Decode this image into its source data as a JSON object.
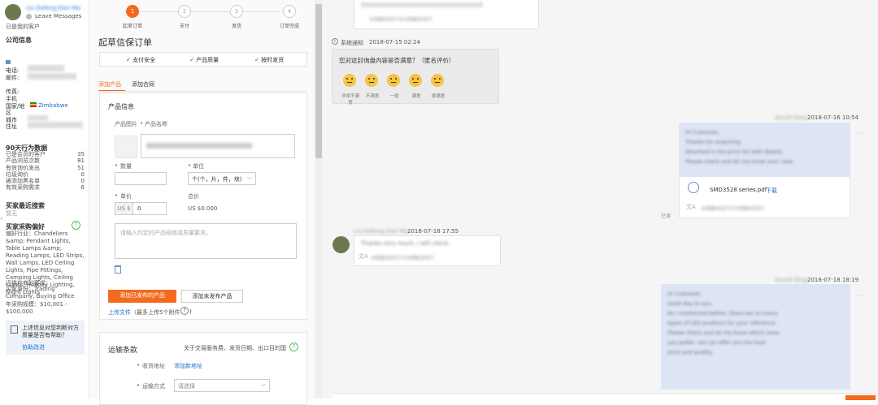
{
  "left": {
    "user_name": "Liu Dafeng Dan Ma",
    "leave_messages": "Leave Messages",
    "visited_customer": "已是我的客户",
    "company_info_title": "公司信息",
    "phone_label": "电话:",
    "email_label": "邮件:",
    "fax_label": "传真:",
    "mobile_label": "手机",
    "country_label": "国家/地",
    "country_value": "Zimbabwe",
    "region_label": "区",
    "city_label": "城市",
    "address_label": "住址",
    "behavior_title": "90天行为数据",
    "stats": [
      {
        "label": "已是会员的客户",
        "value": "35"
      },
      {
        "label": "产品浏览次数",
        "value": "81"
      },
      {
        "label": "有效询价发出",
        "value": "51"
      },
      {
        "label": "垃圾询价",
        "value": "0"
      },
      {
        "label": "被添加黑名单",
        "value": "0"
      },
      {
        "label": "有效采购需求",
        "value": "6"
      }
    ],
    "recent_search_title": "买家最近搜索",
    "recent_search_value": "暂无",
    "preference_title": "买家采购偏好",
    "preference_text": "偏好行业：Chandeliers &amp; Pendant Lights, Table Lamps &amp; Reading Lamps, LED Strips, Wall Lamps, LED Ceiling Lights, Pipe Fittings, Camping Lights, Ceiling Lights, Holiday Lighting, Night Lights",
    "req_title": "近供应商的要求：",
    "identity": "买家身份：Trading Company, Buying Office",
    "annual": "年采购规模：$10,001 - $100,000",
    "feedback_q": "上述信息对您判断对方质量是否有帮助？",
    "feedback_link": "协助改进"
  },
  "mid": {
    "steps": [
      {
        "num": "1",
        "label": "起草订单",
        "active": true
      },
      {
        "num": "2",
        "label": "支付",
        "active": false
      },
      {
        "num": "3",
        "label": "发货",
        "active": false
      },
      {
        "num": "4",
        "label": "订单完成",
        "active": false
      }
    ],
    "title": "起草信保订单",
    "features": [
      "支付安全",
      "产品质量",
      "按时发货"
    ],
    "tab_products": "添加产品",
    "tab_contract": "添加合同",
    "product_info": "产品信息",
    "product_image_label": "产品图片",
    "product_name_label": "产品名称",
    "qty_label": "数量",
    "unit_label": "单位",
    "unit_value": "个(个，片，件，块)",
    "price_label": "单价",
    "total_label": "总价",
    "currency": "US $",
    "price_value": "0",
    "total_value": "US $0.000",
    "desc_placeholder": "请输入约定的产品规格或质量要求。",
    "btn_add_published": "添加已发布的产品",
    "btn_add_unpublished": "添加未发布产品",
    "upload_link": "上传文件",
    "upload_hint": "（最多上传5个附件",
    "shipping_title": "运输条款",
    "shipping_hint": "关于交易服务费、发货日期、出口目的国",
    "addr_label": "收货地址",
    "addr_link": "添加新地址",
    "ship_method_label": "运输方式",
    "ship_method_placeholder": "请选择"
  },
  "right": {
    "top_trans": "对照翻译双行可对照翻译双行",
    "sys_label": "系统通知",
    "sys_time": "2018-07-15 02:24",
    "survey_q": "您对这封询盘内容是否满意？（匿名评价）",
    "ratings": [
      "非常不满意",
      "不满意",
      "一般",
      "满意",
      "很满意"
    ],
    "msg1_time": "2018-07-16 10:54",
    "msg1_sender": "Ancell Ding",
    "msg1_lines": [
      "Hi Customer,",
      "Thanks for enquiring.",
      "Attached is the price list with details.",
      "Please check and let me know your view."
    ],
    "file_name": "SMD3528 series.pdf",
    "file_download": "下载",
    "msg1_trans": "对照翻译双行可对照翻译双行",
    "read_label": "已读",
    "msg2_time": "2018-07-18 17:55",
    "msg2_sender": "Liu Dafeng Dan Ma",
    "msg2_line": "Thanks very much, I will check.",
    "msg2_trans": "对照翻译双行可对照翻译双行",
    "msg3_time": "2018-07-18 18:19",
    "msg3_sender": "Ancell Ding",
    "msg3_lines": [
      "Hi Customer,",
      "Good day to you.",
      "As I mentioned before, there are so many",
      "types of LED products for your reference.",
      "Please check and let me know which ones",
      "you prefer, we can offer you the best",
      "price and quality."
    ]
  }
}
